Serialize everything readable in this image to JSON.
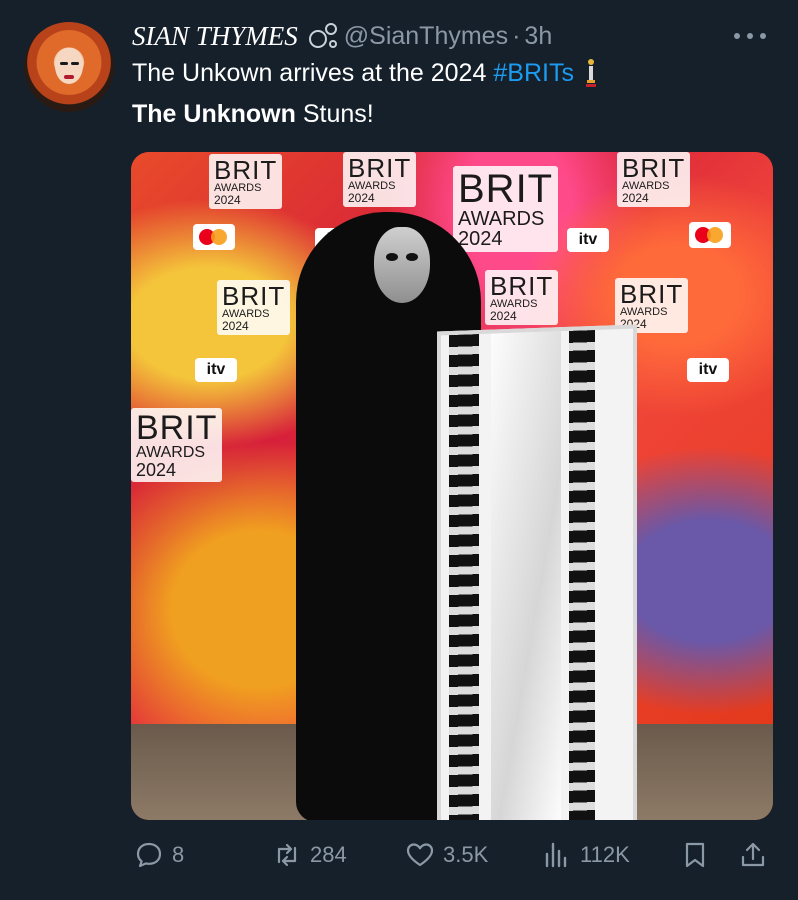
{
  "author": {
    "display_name": "SIAN THYMES",
    "handle": "@SianThymes",
    "separator": "·",
    "time": "3h"
  },
  "tweet": {
    "line1_text": "The Unkown arrives at the 2024",
    "hashtag": "#BRITs",
    "line2_bold": "The Unknown",
    "line2_rest": " Stuns!"
  },
  "media": {
    "logo_word": "BRIT",
    "logo_awards": "AWARDS",
    "logo_year": "2024",
    "itv_label": "itv"
  },
  "actions": {
    "replies": "8",
    "reposts": "284",
    "likes": "3.5K",
    "views": "112K"
  },
  "colors": {
    "background": "#15202b",
    "accent": "#1d9bf0",
    "muted": "#8b98a5"
  },
  "icons": [
    "bubbles-icon",
    "trophy-icon",
    "more-icon",
    "reply-icon",
    "repost-icon",
    "like-icon",
    "views-icon",
    "bookmark-icon",
    "share-icon"
  ]
}
